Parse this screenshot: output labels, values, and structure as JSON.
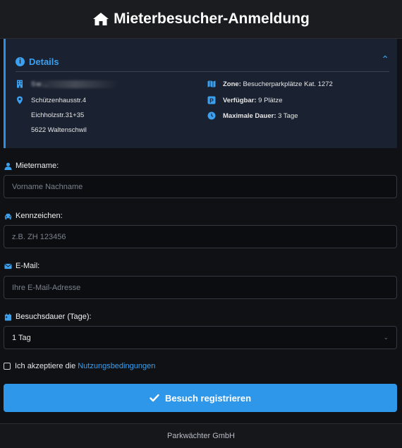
{
  "header": {
    "title": "Mieterbesucher-Anmeldung",
    "icon": "home-icon"
  },
  "details": {
    "title": "Details",
    "collapse_icon": "chevron-up-icon",
    "building_name": "Sw…",
    "address_lines": [
      "Schützenhausstr.4",
      "Eichholzstr.31+35",
      "5622 Waltenschwil"
    ],
    "zone_label": "Zone:",
    "zone_value": "Besucherparkplätze Kat. 1272",
    "available_label": "Verfügbar:",
    "available_value": "9 Plätze",
    "max_duration_label": "Maximale Dauer:",
    "max_duration_value": "3 Tage"
  },
  "form": {
    "tenant_label": "Mietername:",
    "tenant_placeholder": "Vorname Nachname",
    "plate_label": "Kennzeichen:",
    "plate_placeholder": "z.B. ZH 123456",
    "email_label": "E-Mail:",
    "email_placeholder": "Ihre E-Mail-Adresse",
    "duration_label": "Besuchsdauer (Tage):",
    "duration_selected": "1 Tag",
    "terms_text": "Ich akzeptiere die",
    "terms_link": "Nutzungsbedingungen",
    "submit_label": "Besuch registrieren"
  },
  "footer": {
    "text": "Parkwächter GmbH"
  },
  "colors": {
    "accent": "#2e97ea",
    "link": "#3ba0f0",
    "background": "#0f1115"
  }
}
